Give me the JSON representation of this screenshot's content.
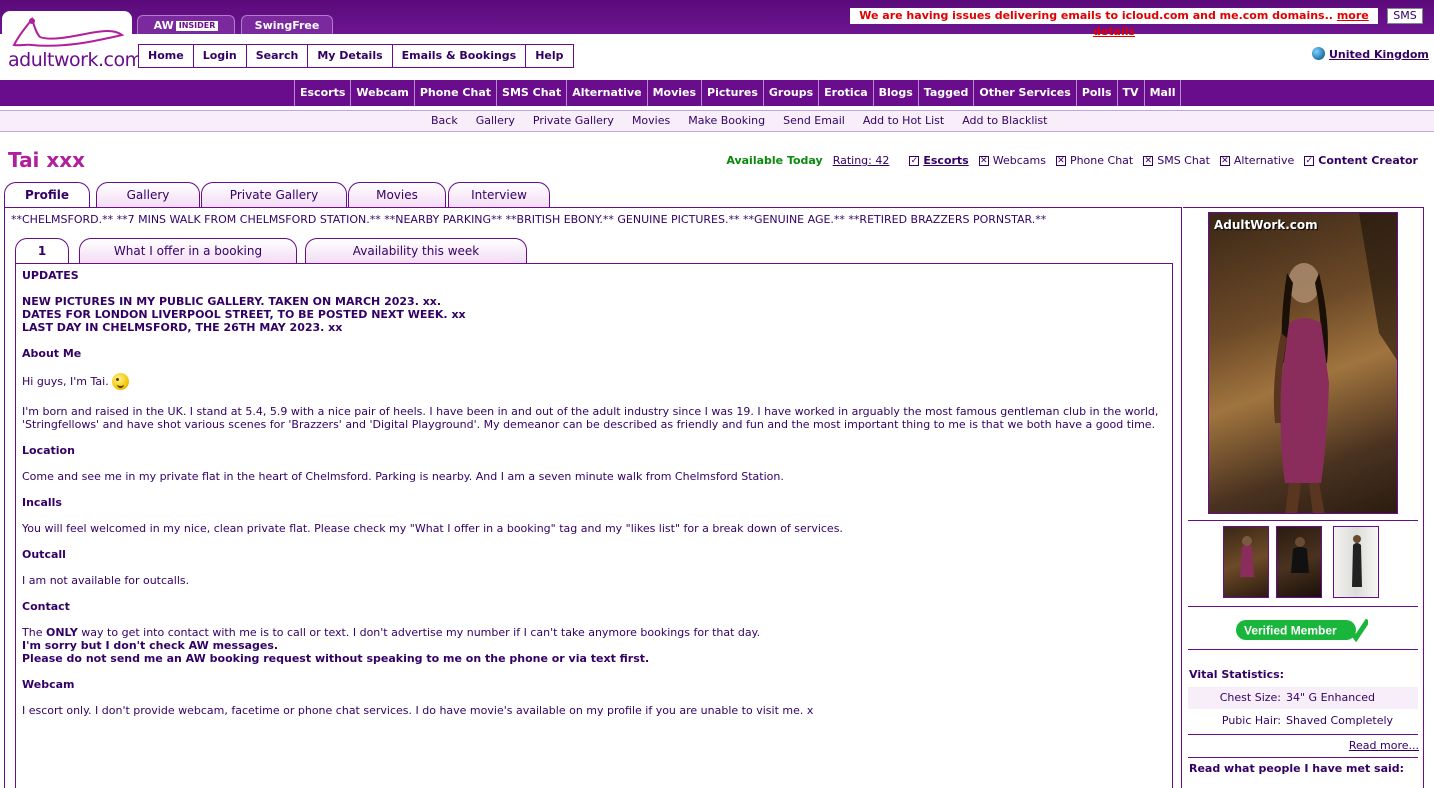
{
  "site": {
    "logo_text": "adultwork.com",
    "top_tabs": {
      "insider_prefix": "AW",
      "insider_badge": "INSIDER",
      "swingfree": "SwingFree"
    },
    "notice": {
      "text": "We are having issues delivering emails to icloud.com and me.com domains..",
      "link": "more details"
    },
    "sms_button": "SMS",
    "country": "United Kingdom"
  },
  "main_nav": [
    "Home",
    "Login",
    "Search",
    "My Details",
    "Emails & Bookings",
    "Help"
  ],
  "category_nav": [
    "Escorts",
    "Webcam",
    "Phone Chat",
    "SMS Chat",
    "Alternative",
    "Movies",
    "Pictures",
    "Groups",
    "Erotica",
    "Blogs",
    "Tagged",
    "Other Services",
    "Polls",
    "TV",
    "Mall"
  ],
  "sub_nav": [
    "Back",
    "Gallery",
    "Private Gallery",
    "Movies",
    "Make Booking",
    "Send Email",
    "Add to Hot List",
    "Add to Blacklist"
  ],
  "profile": {
    "name": "Tai xxx",
    "availability": "Available Today",
    "rating": "Rating: 42",
    "services": [
      {
        "label": "Escorts",
        "checked": true
      },
      {
        "label": "Webcams",
        "checked": false
      },
      {
        "label": "Phone Chat",
        "checked": false
      },
      {
        "label": "SMS Chat",
        "checked": false
      },
      {
        "label": "Alternative",
        "checked": false
      },
      {
        "label": "Content Creator",
        "checked": true
      }
    ]
  },
  "tabs": [
    "Profile",
    "Gallery",
    "Private Gallery",
    "Movies",
    "Interview"
  ],
  "tagline": "**CHELMSFORD.** **7 MINS WALK FROM CHELMSFORD STATION.** **NEARBY PARKING** **BRITISH EBONY.** GENUINE PICTURES.** **GENUINE AGE.** **RETIRED BRAZZERS PORNSTAR.**",
  "sub_tabs": [
    "1",
    "What I offer in a booking",
    "Availability this week"
  ],
  "content": {
    "updates_heading": "UPDATES",
    "updates_line1": "NEW PICTURES IN MY PUBLIC GALLERY. TAKEN ON MARCH 2023. xx.",
    "updates_line2": "DATES FOR LONDON LIVERPOOL STREET, TO BE POSTED NEXT WEEK. xx",
    "updates_line3": "LAST DAY IN CHELMSFORD, THE 26TH MAY 2023. xx",
    "about_heading": "About Me",
    "about_greeting": "Hi guys, I'm Tai.",
    "about_text": "I'm born and raised in the UK. I stand at 5.4, 5.9 with a nice pair of heels. I have been in and out of the adult industry since I was 19. I have worked in arguably the most famous gentleman club in the world, 'Stringfellows' and have shot various scenes for 'Brazzers' and 'Digital Playground'. My demeanor can be described as friendly and fun and the most important thing to me is that we both have a good time.",
    "location_heading": "Location",
    "location_text": "Come and see me in my private flat in the heart of Chelmsford. Parking is nearby. And I am a seven minute walk from Chelmsford Station.",
    "incalls_heading": "Incalls",
    "incalls_text": "You will feel welcomed in my nice, clean private flat. Please check my \"What I offer in a booking\" tag and my \"likes list\" for a break down of services.",
    "outcall_heading": "Outcall",
    "outcall_text": "I am not available for outcalls.",
    "contact_heading": "Contact",
    "contact_pre": "The",
    "contact_only": "ONLY",
    "contact_rest": "way to get into contact with me is to call or text. I don't advertise my number if I can't take anymore bookings for that day.",
    "contact_bold1": "I'm sorry but I don't check AW messages.",
    "contact_bold2": "Please do not send me an AW booking request without speaking to me on the phone or via text first.",
    "webcam_heading": "Webcam",
    "webcam_text": "I escort only. I don't provide webcam, facetime or phone chat services. I do have movie's available on my profile if you are unable to visit me. x"
  },
  "sidebar": {
    "photo_watermark": "AdultWork.com",
    "verified_label": "Verified Member",
    "vital_title": "Vital Statistics:",
    "vitals": [
      {
        "key": "Chest Size:",
        "value": "34\" G Enhanced"
      },
      {
        "key": "Pubic Hair:",
        "value": "Shaved Completely"
      }
    ],
    "read_more": "Read more...",
    "met_title": "Read what people I have met said:"
  }
}
